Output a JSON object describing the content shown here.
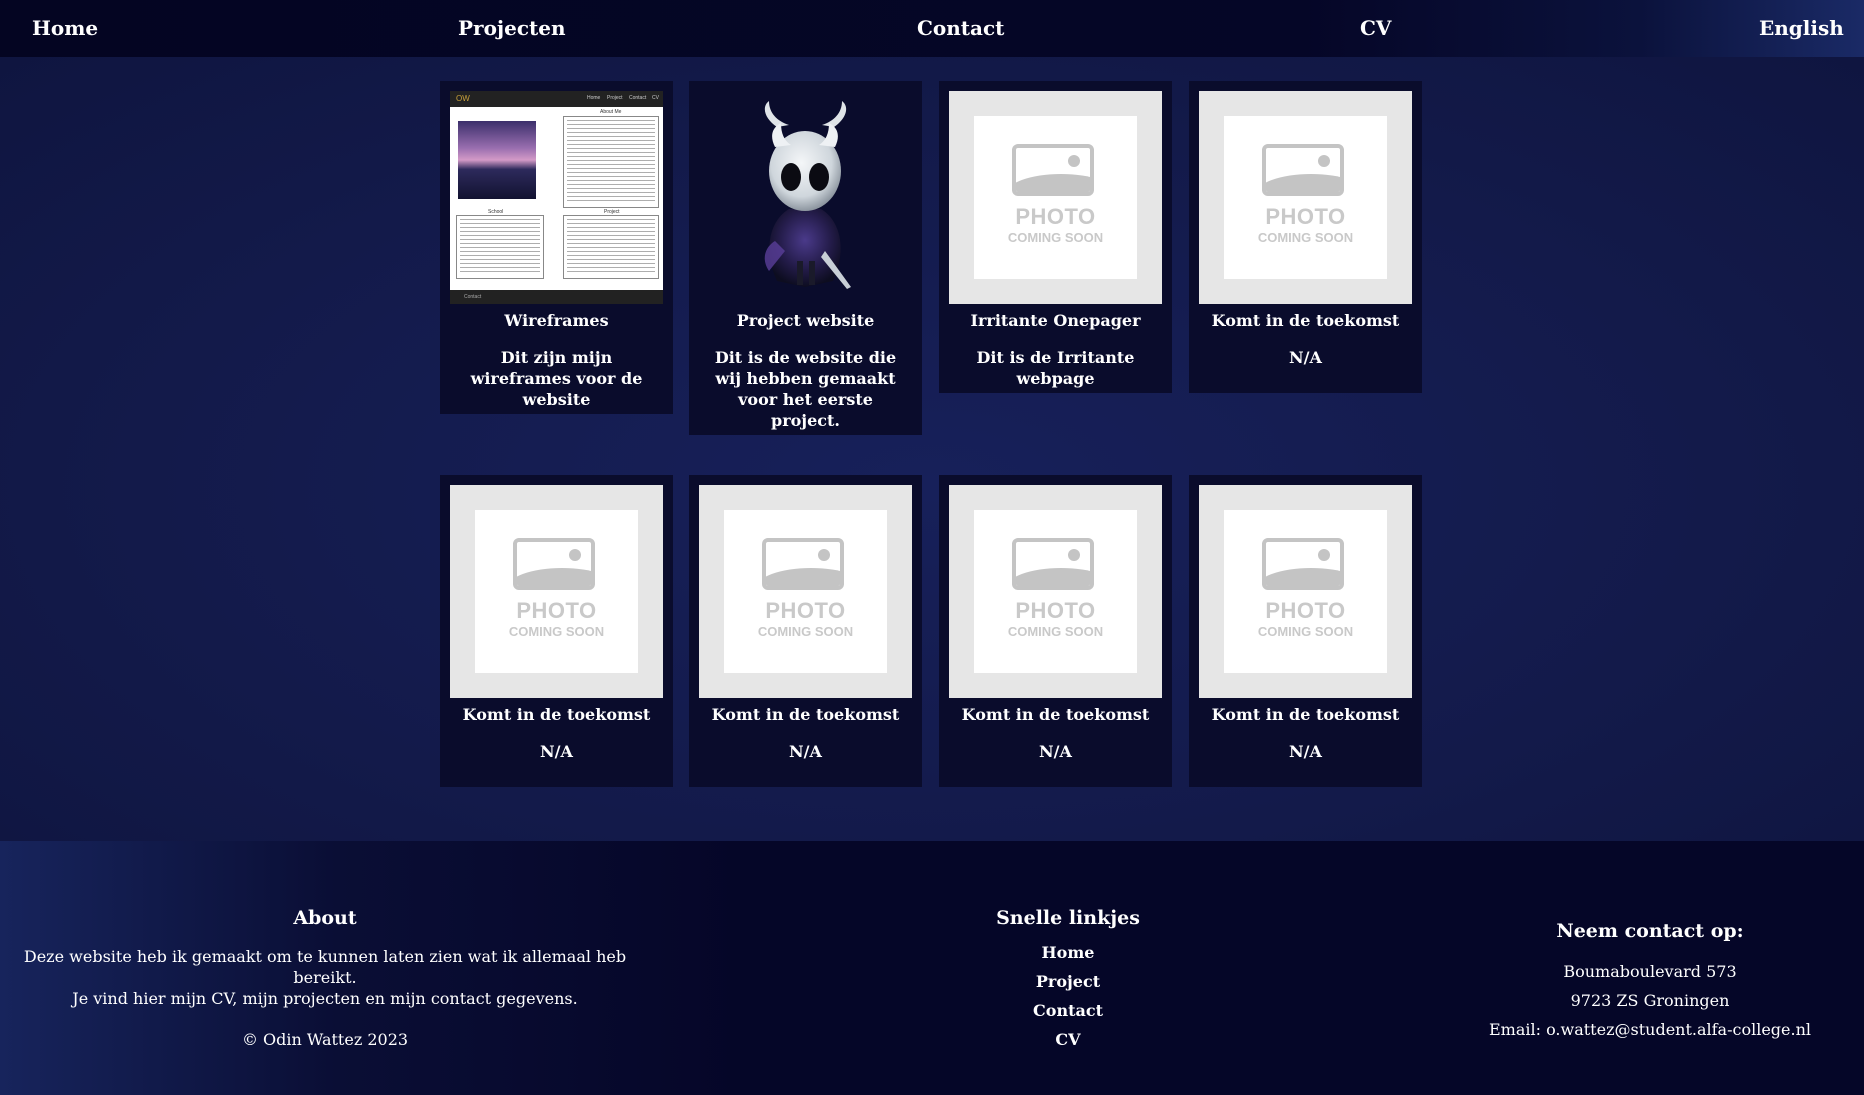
{
  "nav": {
    "home": "Home",
    "projects": "Projecten",
    "contact": "Contact",
    "cv": "CV",
    "language": "English"
  },
  "placeholder": {
    "line1": "PHOTO",
    "line2": "COMING SOON"
  },
  "wireframe_thumb": {
    "logo": "OW",
    "links": [
      "Home",
      "Project",
      "Contact",
      "CV"
    ],
    "about_label": "About Me",
    "school_label": "School",
    "project_label": "Project",
    "footer_label": "Contact"
  },
  "cards": [
    {
      "title": "Wireframes",
      "description": "Dit zijn mijn wireframes voor de website",
      "image": "wireframe-screenshot"
    },
    {
      "title": "Project website",
      "description": "Dit is de website die wij hebben gemaakt voor het eerste project.",
      "image": "hollow-knight-figure"
    },
    {
      "title": "Irritante Onepager",
      "description": "Dit is de Irritante webpage",
      "image": "photo-coming-soon"
    },
    {
      "title": "Komt in de toekomst",
      "description": "N/A",
      "image": "photo-coming-soon"
    },
    {
      "title": "Komt in de toekomst",
      "description": "N/A",
      "image": "photo-coming-soon"
    },
    {
      "title": "Komt in de toekomst",
      "description": "N/A",
      "image": "photo-coming-soon"
    },
    {
      "title": "Komt in de toekomst",
      "description": "N/A",
      "image": "photo-coming-soon"
    },
    {
      "title": "Komt in de toekomst",
      "description": "N/A",
      "image": "photo-coming-soon"
    }
  ],
  "footer": {
    "about": {
      "heading": "About",
      "line1": "Deze website heb ik gemaakt om te kunnen laten zien wat ik allemaal heb bereikt.",
      "line2": "Je vind hier mijn CV, mijn projecten en mijn contact gegevens.",
      "copyright": "© Odin Wattez 2023"
    },
    "quick_links": {
      "heading": "Snelle linkjes",
      "links": [
        "Home",
        "Project",
        "Contact",
        "CV"
      ]
    },
    "contact": {
      "heading": "Neem contact op:",
      "street": "Boumaboulevard 573",
      "city": "9723 ZS Groningen",
      "email": "Email: o.wattez@student.alfa-college.nl"
    }
  },
  "colors": {
    "page_background": "#131a47",
    "nav_background": "#040522",
    "card_background": "#0a0c2c",
    "footer_background": "#050628",
    "text": "#ffffff"
  }
}
